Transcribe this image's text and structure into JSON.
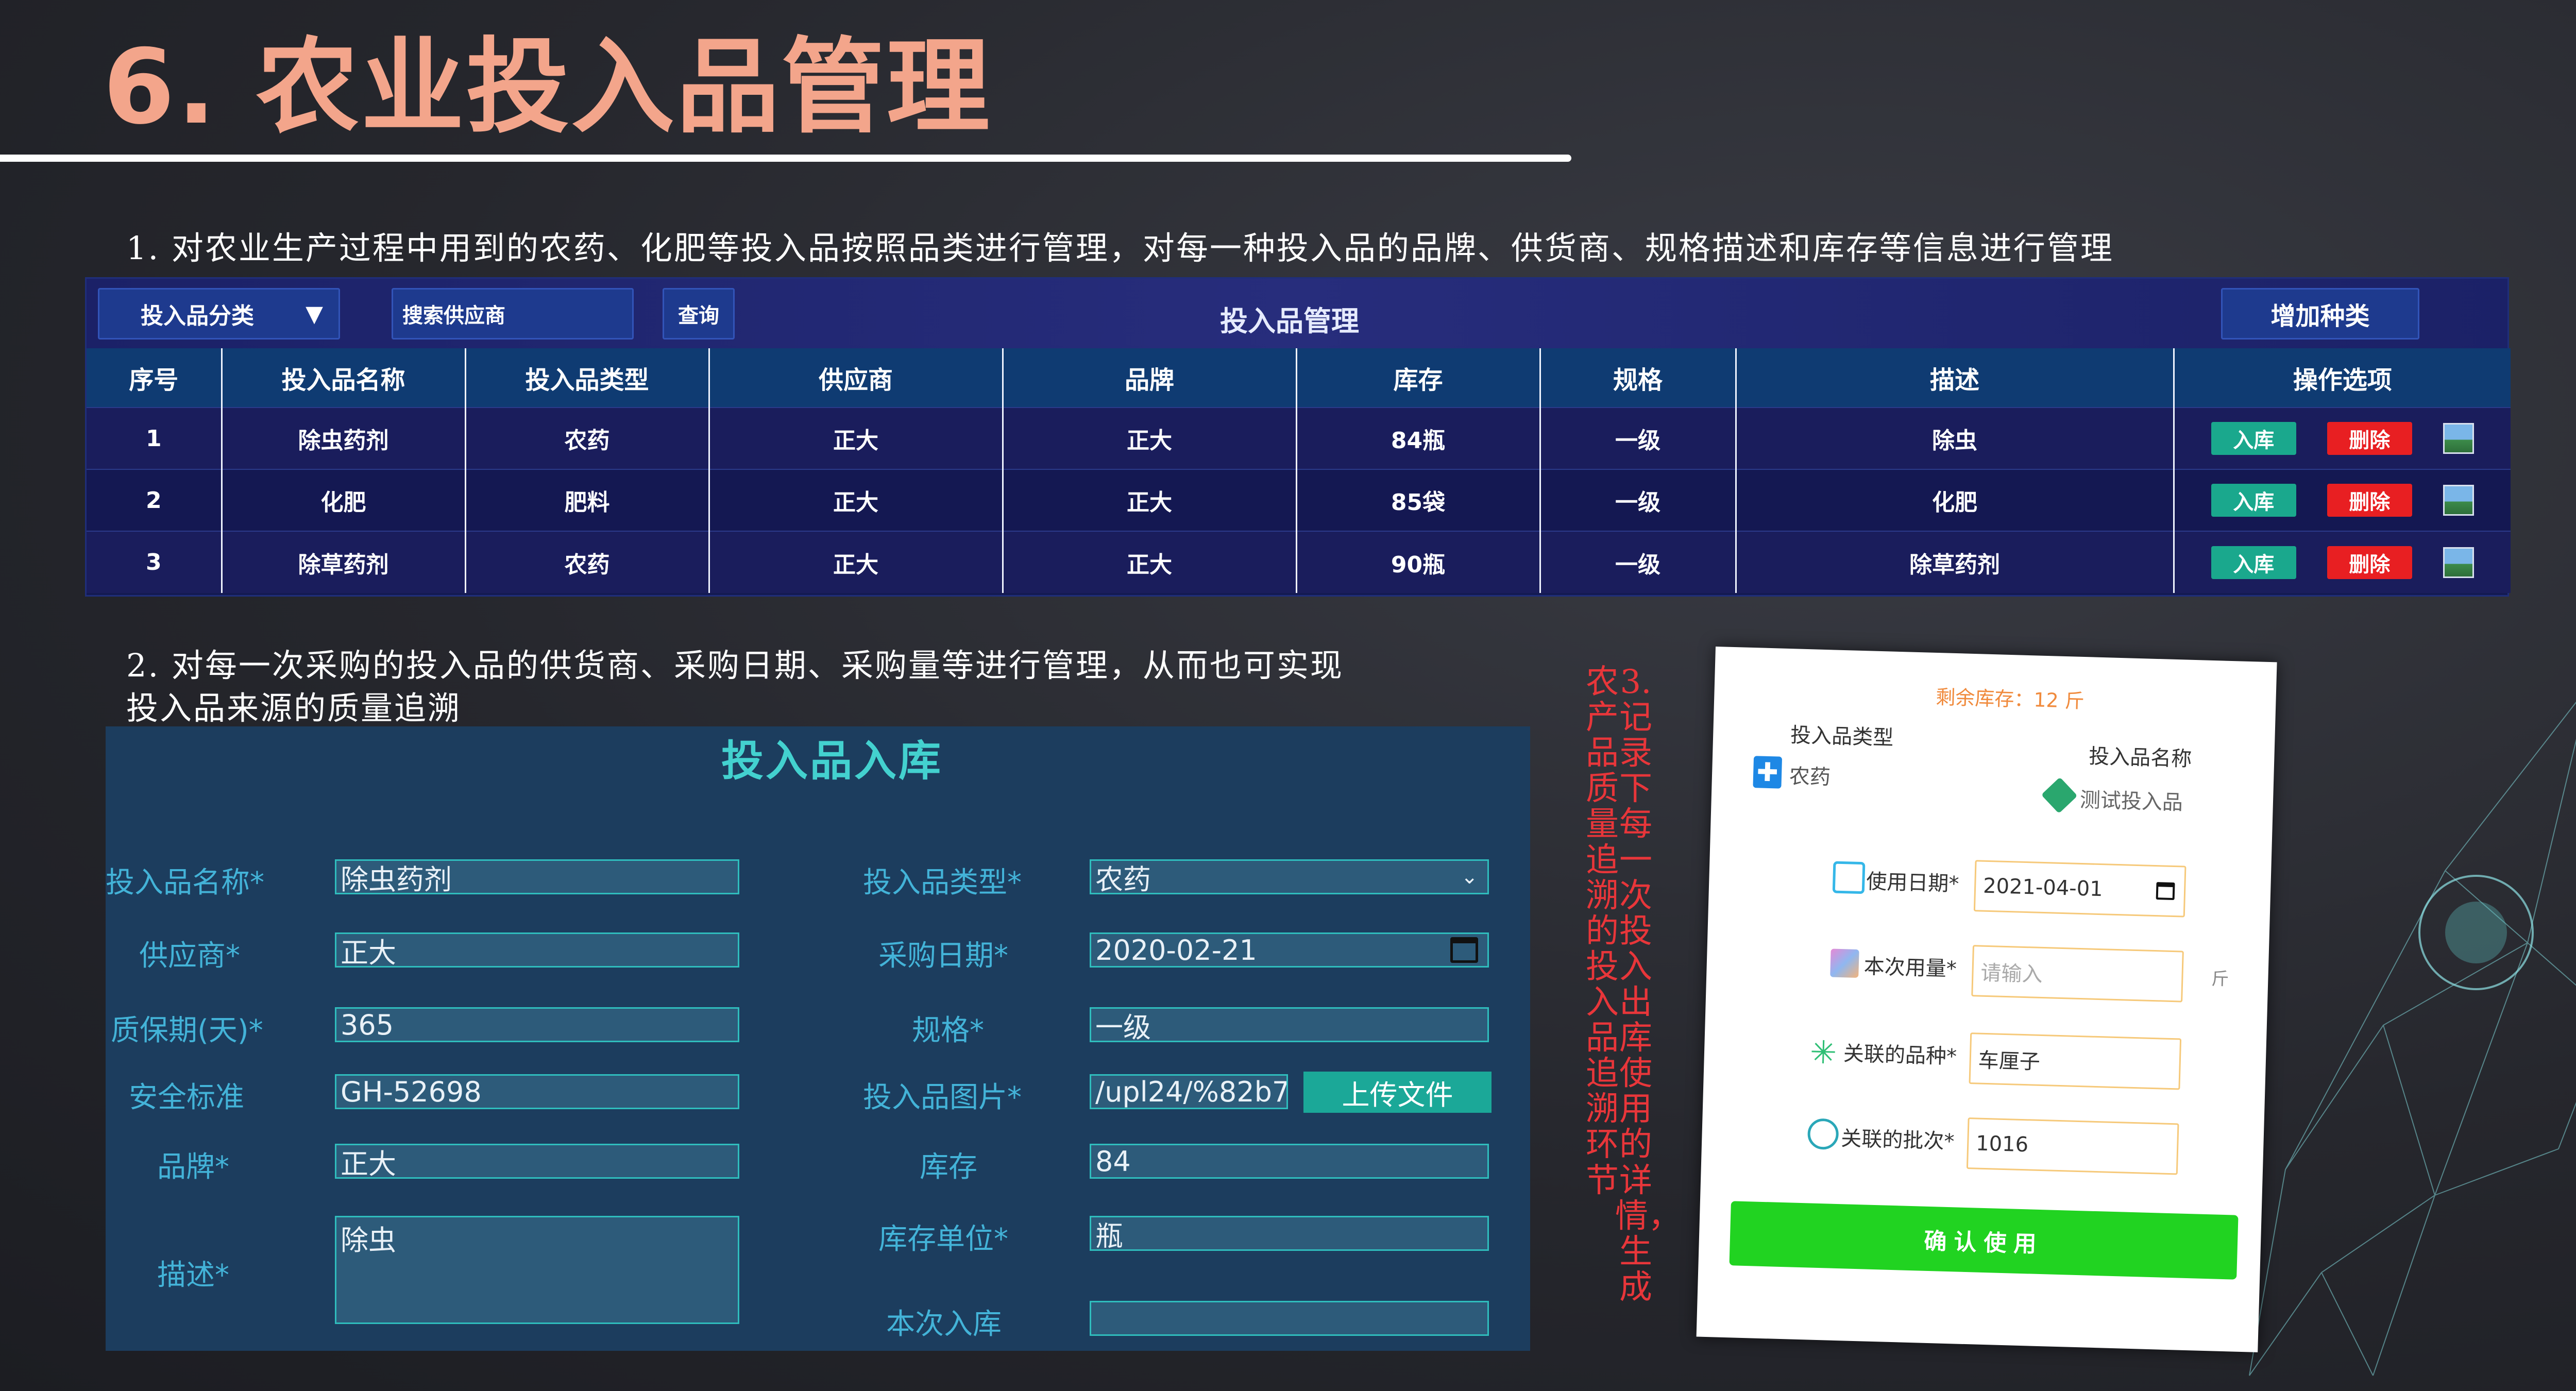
{
  "slide": {
    "title": "6. 农业投入品管理",
    "caption1": "1. 对农业生产过程中用到的农药、化肥等投入品按照品类进行管理，对每一种投入品的品牌、供货商、规格描述和库存等信息进行管理",
    "caption2_line1": "2. 对每一次采购的投入品的供货商、采购日期、采购量等进行管理，从而也可实现",
    "caption2_line2": "投入品来源的质量追溯",
    "caption3_col1": "3.记录下每一次投入出库使用的详情，生成",
    "caption3_col2": "农产品质量追溯的投入品追溯环节"
  },
  "table_panel": {
    "category_dropdown": "投入品分类",
    "supplier_search_placeholder": "搜索供应商",
    "query_button": "查询",
    "title": "投入品管理",
    "add_button": "增加种类",
    "columns": [
      "序号",
      "投入品名称",
      "投入品类型",
      "供应商",
      "品牌",
      "库存",
      "规格",
      "描述",
      "操作选项"
    ],
    "rows": [
      {
        "no": "1",
        "name": "除虫药剂",
        "type": "农药",
        "supplier": "正大",
        "brand": "正大",
        "stock": "84瓶",
        "spec": "一级",
        "desc": "除虫"
      },
      {
        "no": "2",
        "name": "化肥",
        "type": "肥料",
        "supplier": "正大",
        "brand": "正大",
        "stock": "85袋",
        "spec": "一级",
        "desc": "化肥"
      },
      {
        "no": "3",
        "name": "除草药剂",
        "type": "农药",
        "supplier": "正大",
        "brand": "正大",
        "stock": "90瓶",
        "spec": "一级",
        "desc": "除草药剂"
      }
    ],
    "op_in": "入库",
    "op_delete": "删除"
  },
  "inbound_form": {
    "title": "投入品入库",
    "labels": {
      "name": "投入品名称*",
      "supplier": "供应商*",
      "shelf_life": "质保期(天)*",
      "safety_std": "安全标准",
      "brand": "品牌*",
      "desc": "描述*",
      "type": "投入品类型*",
      "purchase_date": "采购日期*",
      "spec": "规格*",
      "image": "投入品图片*",
      "stock": "库存",
      "stock_unit": "库存单位*",
      "this_inbound": "本次入库"
    },
    "values": {
      "name": "除虫药剂",
      "supplier": "正大",
      "shelf_life": "365",
      "safety_std": "GH-52698",
      "brand": "正大",
      "desc": "除虫",
      "type": "农药",
      "purchase_date": "2020-02-21",
      "spec": "一级",
      "image": "/upl24/%82b7",
      "stock": "84",
      "stock_unit": "瓶",
      "this_inbound": ""
    },
    "upload_button": "上传文件"
  },
  "usage_card": {
    "remaining": "剩余库存：12 斤",
    "type_label": "投入品类型",
    "type_value": "农药",
    "name_label": "投入品名称",
    "name_value": "测试投入品",
    "date_label": "使用日期*",
    "date_value": "2021-04-01",
    "amount_label": "本次用量*",
    "amount_placeholder": "请输入",
    "amount_unit": "斤",
    "variety_label": "关联的品种*",
    "variety_value": "车厘子",
    "batch_label": "关联的批次*",
    "batch_value": "1016",
    "confirm_button": "确认使用"
  },
  "colors": {
    "title": "#f3a58b",
    "table_header": "#0f3b72",
    "btn_in": "#1aa88d",
    "btn_delete": "#e81f22",
    "form_label": "#43b3d8",
    "caption3": "#e8363a",
    "confirm": "#21d321"
  }
}
